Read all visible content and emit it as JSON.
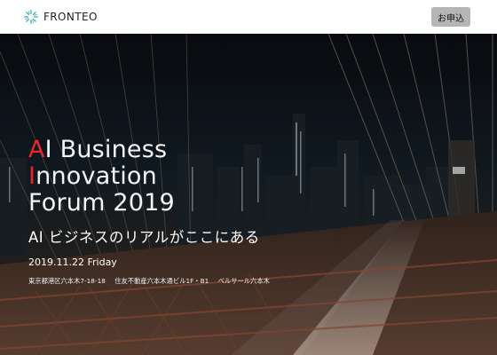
{
  "header": {
    "logo_text": "FRONTEO",
    "apply_label": "お申込"
  },
  "hero": {
    "title": {
      "line1_accent": "A",
      "line1_rest": "I Business",
      "line2_accent": "I",
      "line2_rest": "nnovation",
      "line3": "Forum 2019"
    },
    "subtitle": "AI ビジネスのリアルがここにある",
    "date": "2019.11.22 Friday",
    "venue": {
      "address": "東京都港区六本木7-18-18",
      "building": "住友不動産六本木通ビル1F・B1",
      "hall": "ベルサール六本木"
    }
  },
  "colors": {
    "accent": "#e5252a",
    "button_bg": "#b5b5b5",
    "logo_mark": "#2fa7c9"
  },
  "icons": {
    "logo": "fronteo-sunburst-icon"
  }
}
